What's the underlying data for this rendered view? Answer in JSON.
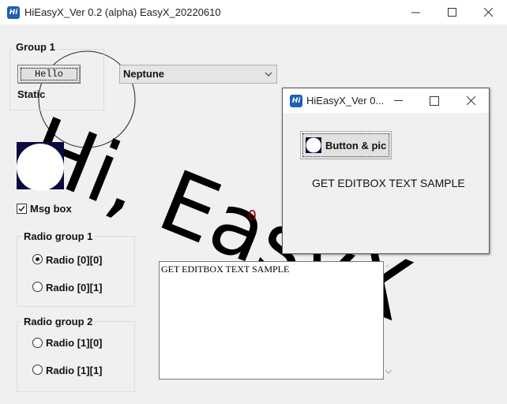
{
  "window": {
    "title": "HiEasyX_Ver 0.2 (alpha)  EasyX_20220610",
    "icon_text": "Hi"
  },
  "group1": {
    "label": "Group 1",
    "hello_button": "Hello",
    "static_label": "Static"
  },
  "combo": {
    "selected": "Neptune"
  },
  "checkbox": {
    "label": "Msg box",
    "checked": true
  },
  "radio_group_1": {
    "label": "Radio group 1",
    "items": [
      {
        "label": "Radio [0][0]",
        "checked": true
      },
      {
        "label": "Radio [0][1]",
        "checked": false
      }
    ]
  },
  "radio_group_2": {
    "label": "Radio group 2",
    "items": [
      {
        "label": "Radio [1][0]",
        "checked": false
      },
      {
        "label": "Radio [1][1]",
        "checked": false
      }
    ]
  },
  "editbox": {
    "value": "GET EDITBOX TEXT SAMPLE"
  },
  "canvas": {
    "big_text": "Hi, EasyX",
    "counter": "0",
    "counter_color": "#8b0000"
  },
  "child_window": {
    "title": "HiEasyX_Ver 0...",
    "icon_text": "Hi",
    "pic_button": "Button & pic",
    "sample_text": "GET EDITBOX TEXT SAMPLE"
  },
  "colors": {
    "icon_blue": "#1e5fb4",
    "pic_square": "#0a0a40"
  }
}
